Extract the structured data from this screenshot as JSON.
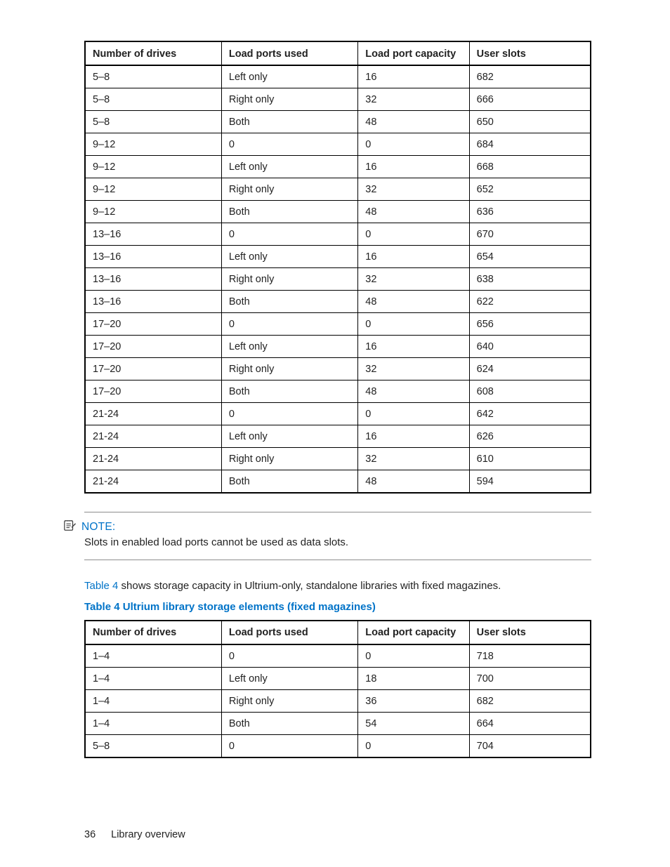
{
  "table1": {
    "headers": [
      "Number of drives",
      "Load ports used",
      "Load port capacity",
      "User slots"
    ],
    "rows": [
      [
        "5–8",
        "Left only",
        "16",
        "682"
      ],
      [
        "5–8",
        "Right only",
        "32",
        "666"
      ],
      [
        "5–8",
        "Both",
        "48",
        "650"
      ],
      [
        "9–12",
        "0",
        "0",
        "684"
      ],
      [
        "9–12",
        "Left only",
        "16",
        "668"
      ],
      [
        "9–12",
        "Right only",
        "32",
        "652"
      ],
      [
        "9–12",
        "Both",
        "48",
        "636"
      ],
      [
        "13–16",
        "0",
        "0",
        "670"
      ],
      [
        "13–16",
        "Left only",
        "16",
        "654"
      ],
      [
        "13–16",
        "Right only",
        "32",
        "638"
      ],
      [
        "13–16",
        "Both",
        "48",
        "622"
      ],
      [
        "17–20",
        "0",
        "0",
        "656"
      ],
      [
        "17–20",
        "Left only",
        "16",
        "640"
      ],
      [
        "17–20",
        "Right only",
        "32",
        "624"
      ],
      [
        "17–20",
        "Both",
        "48",
        "608"
      ],
      [
        "21-24",
        "0",
        "0",
        "642"
      ],
      [
        "21-24",
        "Left only",
        "16",
        "626"
      ],
      [
        "21-24",
        "Right only",
        "32",
        "610"
      ],
      [
        "21-24",
        "Both",
        "48",
        "594"
      ]
    ]
  },
  "note": {
    "label": "NOTE:",
    "body": "Slots in enabled load ports cannot be used as data slots."
  },
  "para": {
    "link": "Table 4",
    "rest": " shows storage capacity in Ultrium-only, standalone libraries with fixed magazines."
  },
  "table2_title": "Table 4 Ultrium library storage elements (fixed magazines)",
  "table2": {
    "headers": [
      "Number of drives",
      "Load ports used",
      "Load port capacity",
      "User slots"
    ],
    "rows": [
      [
        "1–4",
        "0",
        "0",
        "718"
      ],
      [
        "1–4",
        "Left only",
        "18",
        "700"
      ],
      [
        "1–4",
        "Right only",
        "36",
        "682"
      ],
      [
        "1–4",
        "Both",
        "54",
        "664"
      ],
      [
        "5–8",
        "0",
        "0",
        "704"
      ]
    ]
  },
  "footer": {
    "page_number": "36",
    "title": "Library overview"
  }
}
